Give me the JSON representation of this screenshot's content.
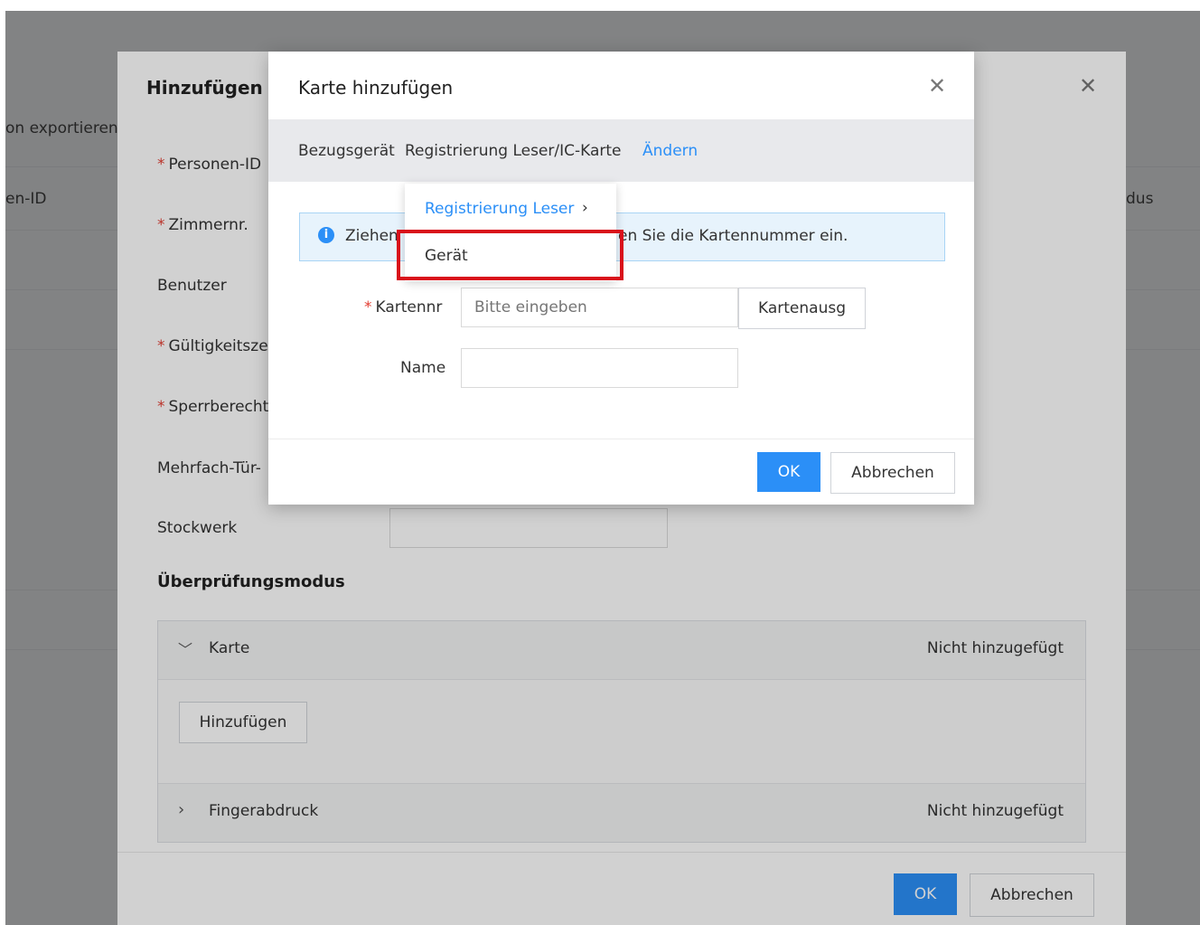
{
  "background": {
    "toolbar_text": "on exportieren",
    "col_left": "en-ID",
    "col_right": "dus"
  },
  "outer_dialog": {
    "title": "Hinzufügen",
    "fields": {
      "personen_id": "Personen-ID",
      "zimmernr": "Zimmernr.",
      "benutzer": "Benutzer",
      "gueltigkeit": "Gültigkeitsze",
      "sperr": "Sperrberecht",
      "mehrfach": "Mehrfach-Tür-",
      "stockwerk": "Stockwerk"
    },
    "section_title": "Überprüfungsmodus",
    "karte": {
      "label": "Karte",
      "status": "Nicht hinzugefügt",
      "add_button": "Hinzufügen"
    },
    "finger": {
      "label": "Fingerabdruck",
      "status": "Nicht hinzugefügt"
    },
    "ok": "OK",
    "cancel": "Abbrechen"
  },
  "inner_dialog": {
    "title": "Karte hinzufügen",
    "source_label": "Bezugsgerät",
    "source_value": "Registrierung Leser/IC-Karte",
    "change_link": "Ändern",
    "info_text_left": "Ziehen",
    "info_text_right": "en Sie die Kartennummer ein.",
    "card_label": "Kartennr",
    "card_placeholder": "Bitte eingeben",
    "card_button": "Kartenausg",
    "name_label": "Name",
    "name_value": "",
    "ok": "OK",
    "cancel": "Abbrechen"
  },
  "dropdown": {
    "item1": "Registrierung Leser",
    "item2": "Gerät"
  },
  "colors": {
    "primary": "#2b8ff7",
    "highlight": "#d9111b",
    "required": "#e33e33"
  }
}
